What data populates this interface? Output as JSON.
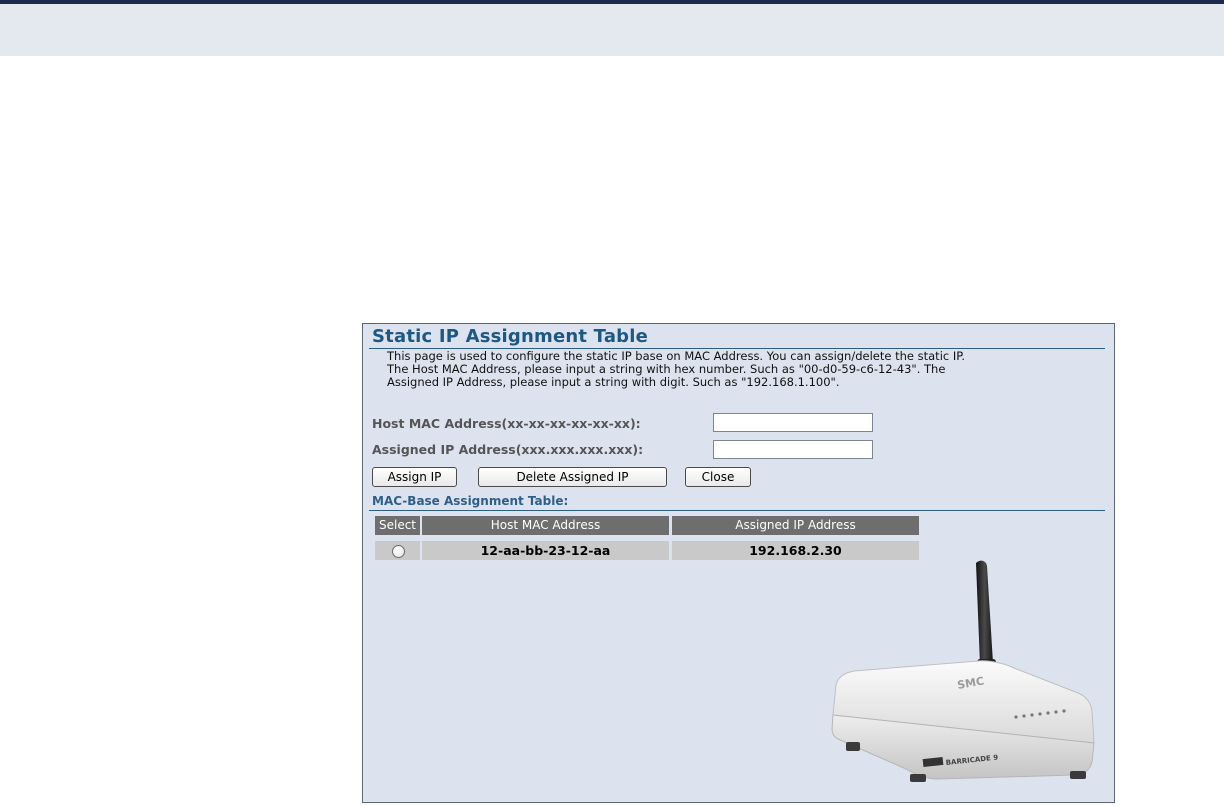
{
  "page": {
    "title": "Static IP Assignment Table",
    "description": [
      "This page is used to configure the static IP base on MAC Address. You can assign/delete the static IP.",
      "The Host MAC Address, please input a string with hex number. Such as \"00-d0-59-c6-12-43\". The",
      "Assigned IP Address, please input a string with digit. Such as \"192.168.1.100\"."
    ]
  },
  "form": {
    "mac_label": "Host MAC Address(xx-xx-xx-xx-xx-xx):",
    "mac_value": "",
    "ip_label": "Assigned IP Address(xxx.xxx.xxx.xxx):",
    "ip_value": ""
  },
  "buttons": {
    "assign": "Assign IP",
    "delete": "Delete Assigned IP",
    "close": "Close"
  },
  "table": {
    "title": "MAC-Base Assignment Table:",
    "headers": [
      "Select",
      "Host MAC Address",
      "Assigned IP Address"
    ],
    "rows": [
      {
        "selected": false,
        "mac": "12-aa-bb-23-12-aa",
        "ip": "192.168.2.30"
      }
    ]
  },
  "router_image": {
    "logo_text": "SMC",
    "model_text": "BARRICADE 9"
  },
  "colors": {
    "panel_bg": "#dde3ee",
    "title": "#1d5783",
    "header_bg": "#6e6e6e",
    "cell_bg": "#c9c9c9",
    "top_rule": "#1b2a4e"
  }
}
